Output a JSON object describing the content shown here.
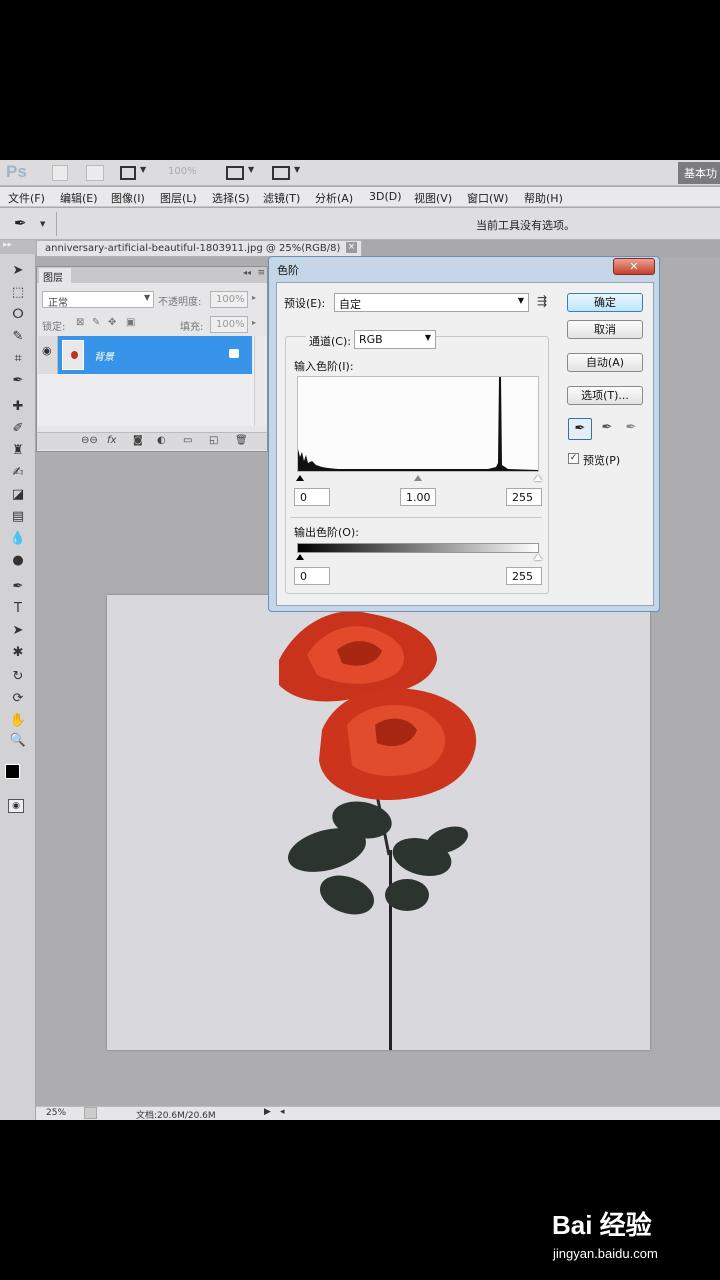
{
  "app": {
    "logo": "Ps",
    "zoom_select": "100%",
    "workspace": "基本功"
  },
  "menubar": [
    "文件(F)",
    "编辑(E)",
    "图像(I)",
    "图层(L)",
    "选择(S)",
    "滤镜(T)",
    "分析(A)",
    "3D(D)",
    "视图(V)",
    "窗口(W)",
    "帮助(H)"
  ],
  "options_bar": {
    "hint": "当前工具没有选项。"
  },
  "document_tab": {
    "title": "anniversary-artificial-beautiful-1803911.jpg @ 25%(RGB/8)",
    "close": "×"
  },
  "layers_panel": {
    "tab": "图层",
    "blend_mode": "正常",
    "opacity_label": "不透明度:",
    "opacity_value": "100%",
    "lock_label": "锁定:",
    "fill_label": "填充:",
    "fill_value": "100%",
    "layer_name": "背景",
    "footer_icons": [
      "链接",
      "fx",
      "蒙版",
      "调整",
      "组",
      "新建",
      "删除"
    ]
  },
  "levels_dialog": {
    "title": "色阶",
    "close": "✕",
    "preset_label": "预设(E):",
    "preset_value": "自定",
    "channel_label": "通道(C):",
    "channel_value": "RGB",
    "input_label": "输入色阶(I):",
    "input_black": "0",
    "input_gamma": "1.00",
    "input_white": "255",
    "output_label": "输出色阶(O):",
    "output_black": "0",
    "output_white": "255",
    "buttons": {
      "ok": "确定",
      "cancel": "取消",
      "auto": "自动(A)",
      "options": "选项(T)..."
    },
    "preview_label": "预览(P)",
    "preview_checked": true
  },
  "status_bar": {
    "zoom": "25%",
    "doc_info": "文档:20.6M/20.6M"
  },
  "watermark": {
    "brand": "Bai 经验",
    "url": "jingyan.baidu.com"
  },
  "colors": {
    "accent_blue": "#3794e8",
    "rose_red": "#d6391f",
    "dialog_frame": "#c5d6e9"
  }
}
